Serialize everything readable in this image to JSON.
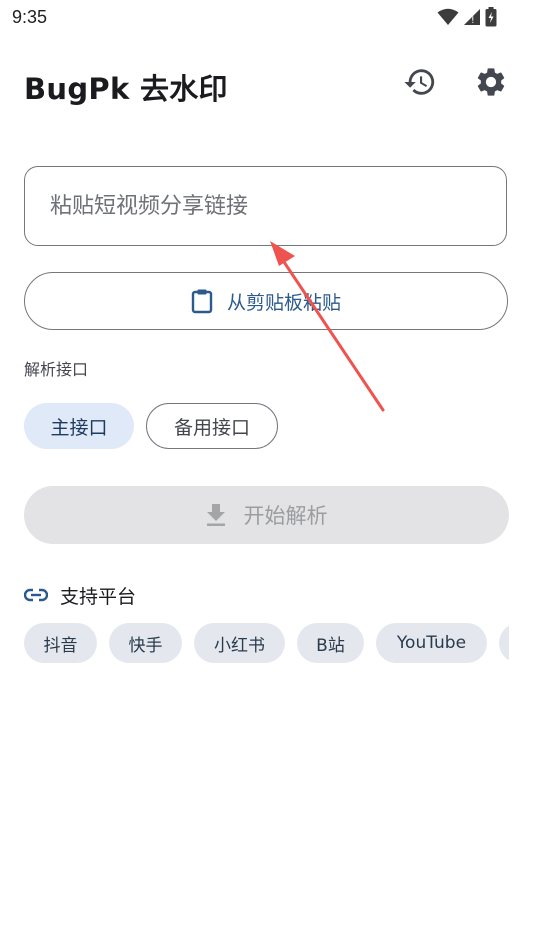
{
  "status_bar": {
    "time": "9:35"
  },
  "app_bar": {
    "title": "BugPk 去水印",
    "history_icon": "history-icon",
    "settings_icon": "gear-icon"
  },
  "input": {
    "placeholder": "粘贴短视频分享链接",
    "value": ""
  },
  "paste_button": {
    "label": "从剪贴板粘贴",
    "icon": "clipboard-icon"
  },
  "api_section": {
    "label": "解析接口",
    "options": [
      {
        "label": "主接口",
        "selected": true
      },
      {
        "label": "备用接口",
        "selected": false
      }
    ]
  },
  "parse_button": {
    "label": "开始解析",
    "icon": "download-icon",
    "enabled": false
  },
  "platforms": {
    "header": "支持平台",
    "icon": "link-icon",
    "items": [
      "抖音",
      "快手",
      "小红书",
      "B站",
      "YouTube"
    ]
  },
  "colors": {
    "primary": "#2b5a8c",
    "chip_selected_bg": "#dfe9f8",
    "annotation_arrow": "#ef5350",
    "disabled_bg": "#e3e3e6"
  }
}
